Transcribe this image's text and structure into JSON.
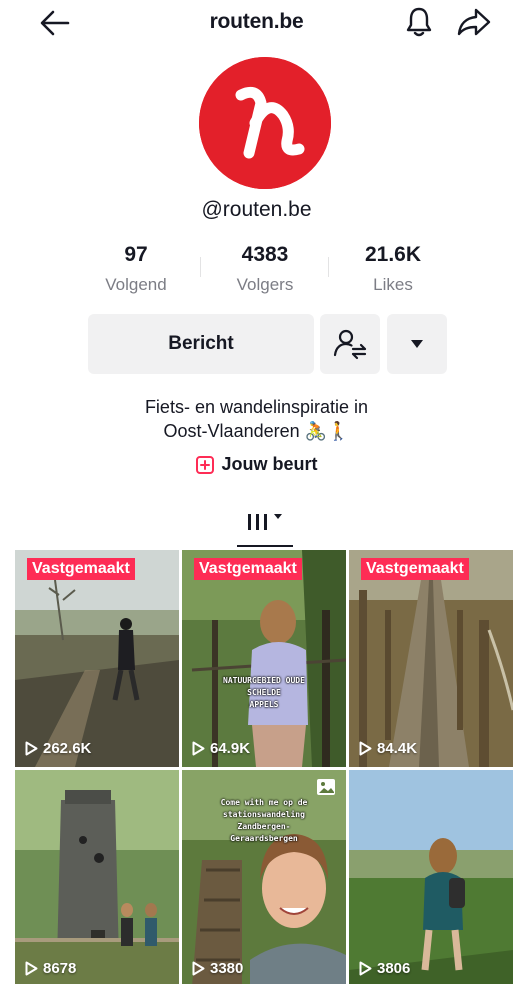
{
  "header": {
    "title": "routen.be",
    "back_icon": "arrow-left-icon",
    "bell_icon": "bell-icon",
    "share_icon": "share-icon"
  },
  "profile": {
    "handle": "@routen.be",
    "avatar_color": "#e3202a",
    "stats": [
      {
        "value": "97",
        "label": "Volgend"
      },
      {
        "value": "4383",
        "label": "Volgers"
      },
      {
        "value": "21.6K",
        "label": "Likes"
      }
    ],
    "buttons": {
      "message_label": "Bericht",
      "follow_icon": "user-switch-icon",
      "more_icon": "caret-down-icon"
    },
    "bio_line1": "Fiets- en wandelinspiratie in",
    "bio_line2": "Oost-Vlaanderen 🚴🚶",
    "turn_label": "Jouw beurt"
  },
  "tabs": {
    "videos_icon": "grid-videos-icon"
  },
  "videos": [
    {
      "pinned_label": "Vastgemaakt",
      "views": "262.6K"
    },
    {
      "pinned_label": "Vastgemaakt",
      "views": "64.9K",
      "overlay": [
        "NATUURGEBIED OUDE",
        "SCHELDE",
        "APPELS"
      ]
    },
    {
      "pinned_label": "Vastgemaakt",
      "views": "84.4K"
    },
    {
      "views": "8678"
    },
    {
      "views": "3380",
      "overlay": [
        "Come with me op de",
        "stationswandeling",
        "Zandbergen-",
        "Geraardsbergen"
      ]
    },
    {
      "views": "3806"
    }
  ],
  "colors": {
    "pin": "#fe2c55",
    "button_bg": "#f1f1f2",
    "secondary_text": "#7c7d85"
  }
}
